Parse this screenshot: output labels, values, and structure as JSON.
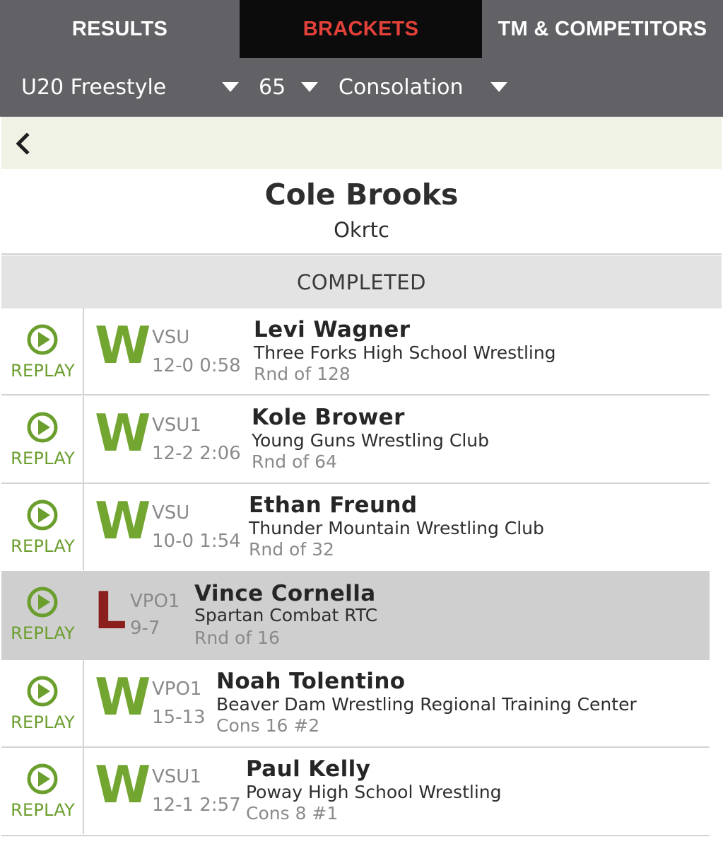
{
  "tabs": [
    {
      "label": "RESULTS"
    },
    {
      "label": "BRACKETS"
    },
    {
      "label": "TM & COMPETITORS"
    }
  ],
  "filters": {
    "style": "U20 Freestyle",
    "weight": "65",
    "bracket": "Consolation"
  },
  "athlete": {
    "name": "Cole Brooks",
    "team": "Okrtc"
  },
  "section_label": "COMPLETED",
  "replay_label": "REPLAY",
  "colors": {
    "win": "#73a531",
    "loss": "#8a1f1d",
    "active_tab": "#e3413a",
    "header_bg": "#626266",
    "back_bar_bg": "#eff2e5"
  },
  "icons": {
    "back": "chevron-left-icon",
    "play": "play-circle-icon",
    "dropdown": "caret-down-icon"
  },
  "matches": [
    {
      "result": "W",
      "type": "VSU",
      "score": "12-0 0:58",
      "opponent": "Levi Wagner",
      "club": "Three Forks High School Wrestling",
      "round": "Rnd of 128"
    },
    {
      "result": "W",
      "type": "VSU1",
      "score": "12-2 2:06",
      "opponent": "Kole Brower",
      "club": "Young Guns Wrestling Club",
      "round": "Rnd of 64"
    },
    {
      "result": "W",
      "type": "VSU",
      "score": "10-0 1:54",
      "opponent": "Ethan Freund",
      "club": "Thunder Mountain Wrestling Club",
      "round": "Rnd of 32"
    },
    {
      "result": "L",
      "type": "VPO1",
      "score": "9-7",
      "opponent": "Vince Cornella",
      "club": "Spartan Combat RTC",
      "round": "Rnd of 16"
    },
    {
      "result": "W",
      "type": "VPO1",
      "score": "15-13",
      "opponent": "Noah Tolentino",
      "club": "Beaver Dam Wrestling Regional Training Center",
      "round": "Cons 16 #2"
    },
    {
      "result": "W",
      "type": "VSU1",
      "score": "12-1 2:57",
      "opponent": "Paul Kelly",
      "club": "Poway High School Wrestling",
      "round": "Cons 8 #1"
    }
  ]
}
